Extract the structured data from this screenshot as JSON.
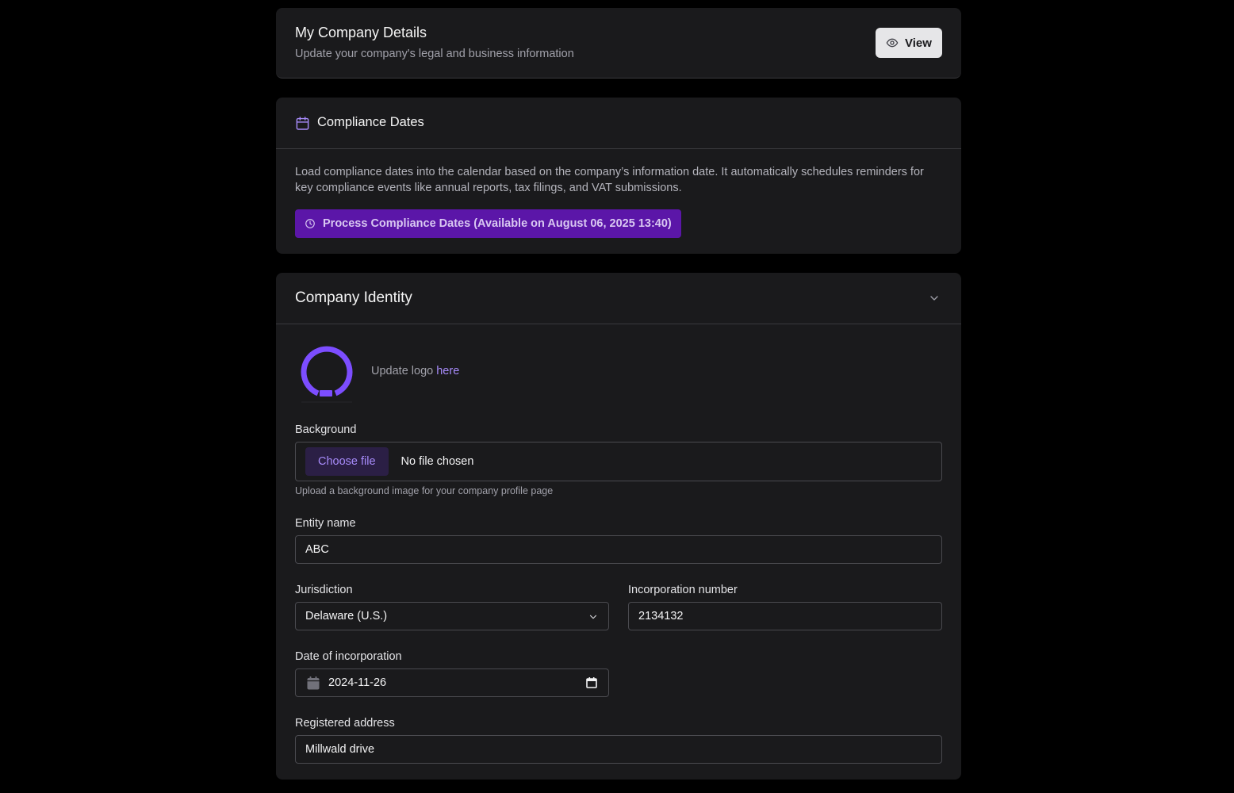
{
  "header": {
    "title": "My Company Details",
    "subtitle": "Update your company's legal and business information",
    "view_label": "View"
  },
  "compliance": {
    "title": "Compliance Dates",
    "description": "Load compliance dates into the calendar based on the company’s information date. It automatically schedules reminders for key compliance events like annual reports, tax filings, and VAT submissions.",
    "button_label": "Process Compliance Dates (Available on August 06, 2025 13:40)"
  },
  "identity": {
    "title": "Company Identity",
    "logo_text": "Update logo ",
    "logo_link": "here",
    "background": {
      "label": "Background",
      "button": "Choose file",
      "status": "No file chosen",
      "hint": "Upload a background image for your company profile page"
    },
    "entity_name": {
      "label": "Entity name",
      "value": "ABC"
    },
    "jurisdiction": {
      "label": "Jurisdiction",
      "value": "Delaware (U.S.)"
    },
    "incorporation_number": {
      "label": "Incorporation number",
      "value": "2134132"
    },
    "date_of_incorporation": {
      "label": "Date of incorporation",
      "value": "2024-11-26"
    },
    "registered_address": {
      "label": "Registered address",
      "value": "Millwald drive"
    }
  },
  "icons": [
    "eye-icon",
    "calendar-icon",
    "clock-icon",
    "chevron-down-icon",
    "logo-ring",
    "calendar-picker-icon"
  ],
  "colors": {
    "background": "#000000",
    "card": "#1a1a1c",
    "accent": "#5b16a8",
    "link": "#a78bfa"
  }
}
